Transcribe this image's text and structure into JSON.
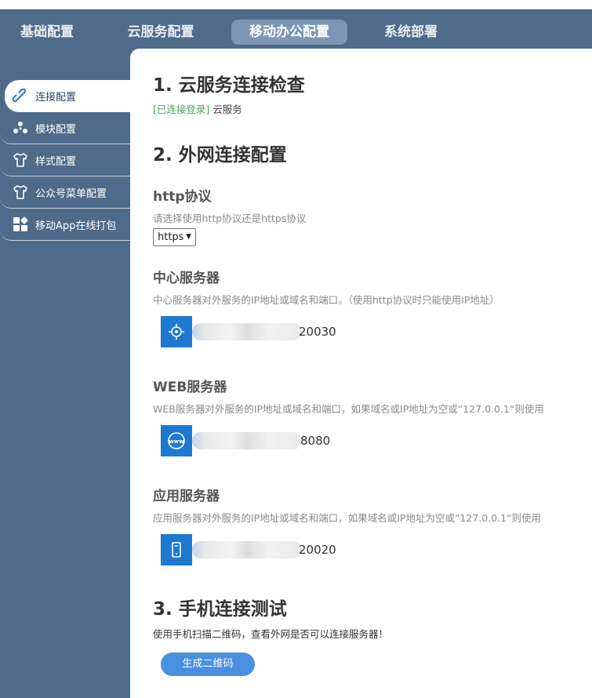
{
  "nav": {
    "tabs": [
      {
        "label": "基础配置"
      },
      {
        "label": "云服务配置"
      },
      {
        "label": "移动办公配置"
      },
      {
        "label": "系统部署"
      }
    ]
  },
  "sidebar": {
    "items": [
      {
        "label": "连接配置",
        "icon": "link-icon"
      },
      {
        "label": "模块配置",
        "icon": "modules-icon"
      },
      {
        "label": "样式配置",
        "icon": "shirt-icon"
      },
      {
        "label": "公众号菜单配置",
        "icon": "shirt-icon"
      },
      {
        "label": "移动App在线打包",
        "icon": "apps-icon"
      }
    ]
  },
  "section1": {
    "title": "1. 云服务连接检查",
    "status_tag": "[已连接登录]",
    "status_text": "云服务"
  },
  "section2": {
    "title": "2. 外网连接配置",
    "http": {
      "label": "http协议",
      "desc": "请选择使用http协议还是https协议",
      "selected": "https"
    },
    "center_server": {
      "label": "中心服务器",
      "desc": "中心服务器对外服务的IP地址或域名和端口。（使用http协议时只能使用IP地址）",
      "value_suffix": "20030"
    },
    "web_server": {
      "label": "WEB服务器",
      "desc": "WEB服务器对外服务的IP地址或域名和端口，如果域名或IP地址为空或”127.0.0.1“则使用",
      "value_suffix": "8080"
    },
    "app_server": {
      "label": "应用服务器",
      "desc": "应用服务器对外服务的IP地址或域名和端口，如果域名或IP地址为空或”127.0.0.1“则使用",
      "value_suffix": "20020"
    }
  },
  "section3": {
    "title": "3. 手机连接测试",
    "desc": "使用手机扫描二维码，查看外网是否可以连接服务器！",
    "button": "生成二维码"
  },
  "colors": {
    "accent": "#1e7ad0",
    "nav_bg": "#4e6b8a",
    "success": "#4aa75a"
  }
}
